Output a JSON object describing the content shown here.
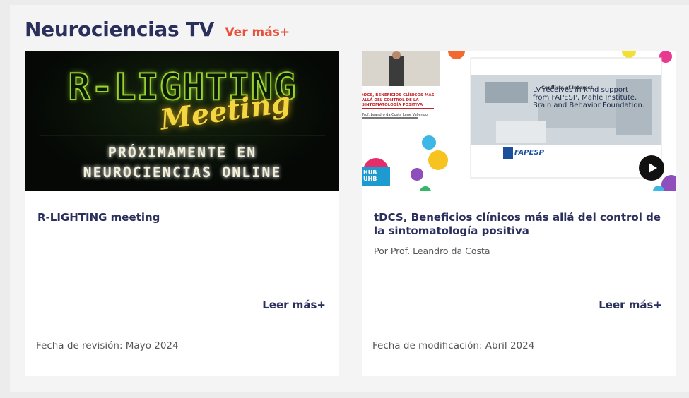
{
  "section": {
    "title": "Neurociencias TV",
    "see_more": "Ver más+"
  },
  "cards": [
    {
      "title": "R-LIGHTING meeting",
      "thumbnail": {
        "headline": "R-LIGHTING",
        "script": "Meeting",
        "line1": "PRÓXIMAMENTE EN",
        "line2": "NEUROCIENCIAS ONLINE"
      },
      "read_more": "Leer más+",
      "date": "Fecha de revisión: Mayo 2024"
    },
    {
      "title": "tDCS, Beneficios clínicos más allá del control de la sintomatología positiva",
      "author": "Por  Prof. Leandro da Costa",
      "thumbnail": {
        "slide_title_left": "tDCS, BENEFICIOS CLÍNICOS MÁS ALLÁ DEL CONTROL DE LA SINTOMATOLOGÍA POSITIVA",
        "presenter": "Prof. Leandro da Costa Lane Valiengo",
        "slide_heading": "Conflicts of Interest",
        "slide_text": "LV receives in-kind support from FAPESP, Mahle Institute, Brain and Behavior Foundation.",
        "logo": "FAPESP",
        "hub": "HUB UHB"
      },
      "read_more": "Leer más+",
      "date": "Fecha de modificación: Abril 2024"
    }
  ],
  "colors": {
    "title": "#2a2f5c",
    "accent": "#e8503a",
    "neon_green": "#9ad232",
    "neon_yellow": "#f3d640"
  },
  "icons": {
    "play": "play-icon"
  }
}
